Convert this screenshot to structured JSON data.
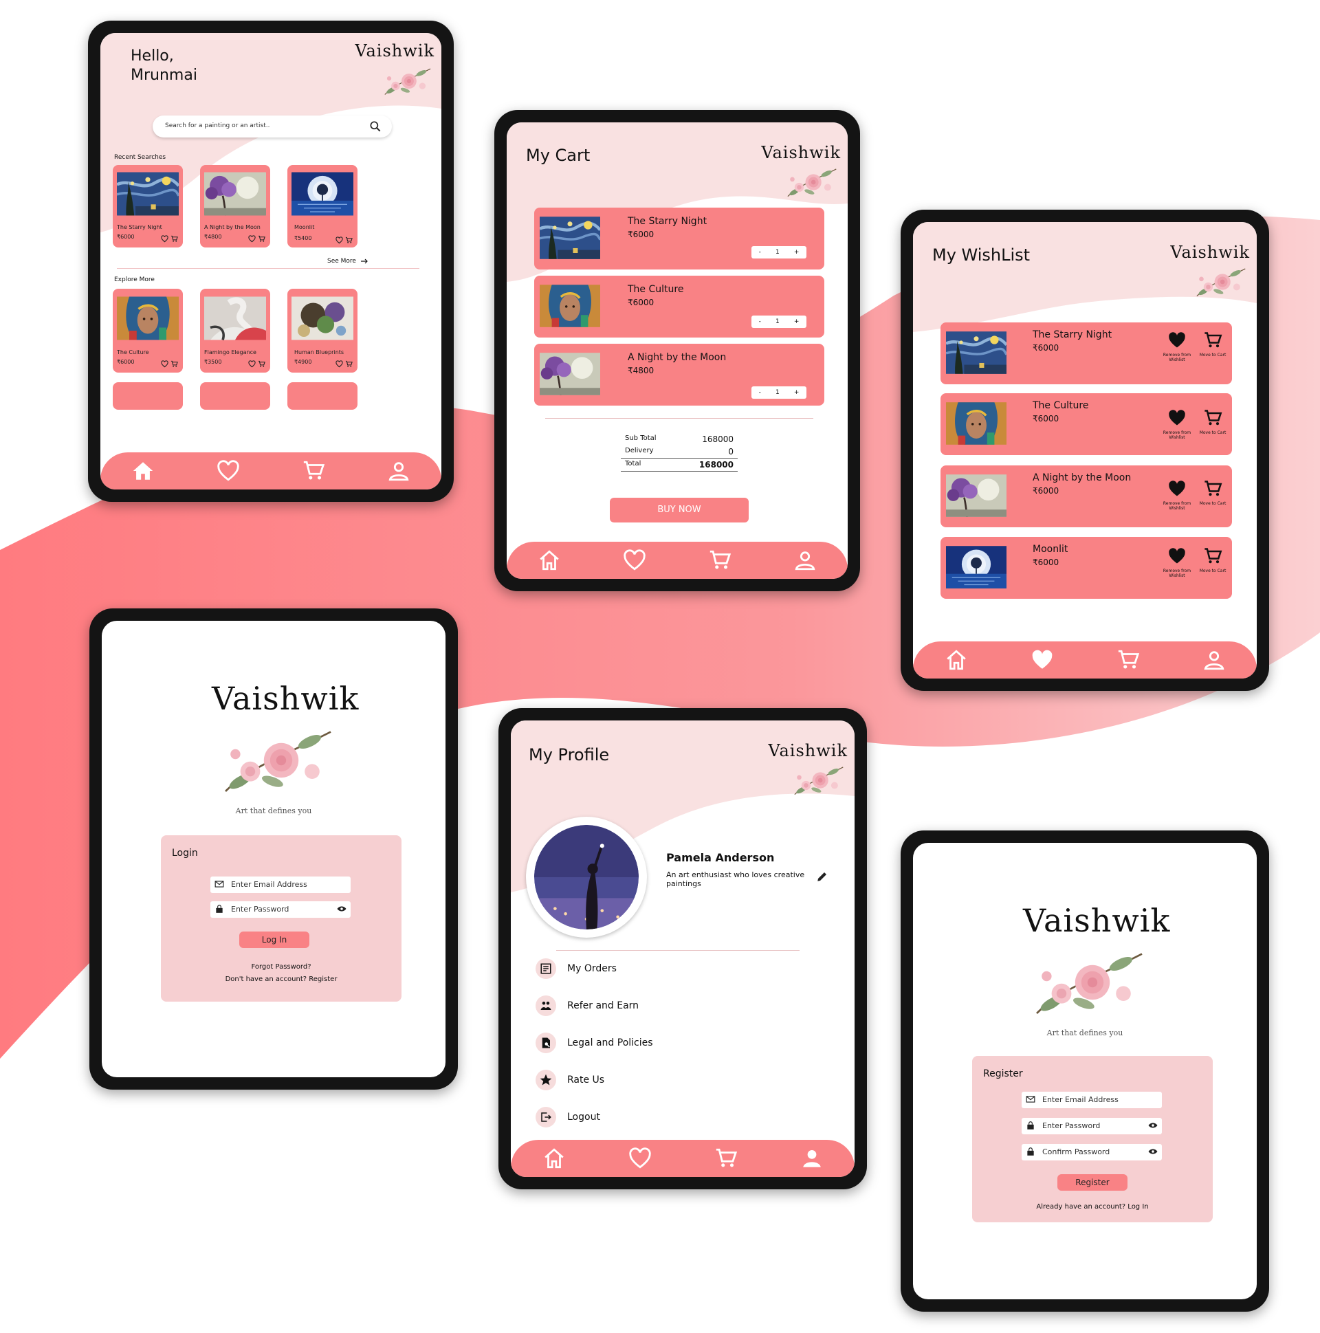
{
  "brand": {
    "name": "Vaishwik",
    "tagline": "Art that defines you",
    "accent": "#f98285",
    "light": "#f9e1e1",
    "panel": "#f6cfd1"
  },
  "home": {
    "greeting_line1": "Hello,",
    "greeting_line2": "Mrunmai",
    "search_placeholder": "Search for a painting or an artist..",
    "recent_label": "Recent Searches",
    "see_more": "See More",
    "explore_label": "Explore More",
    "recent": [
      {
        "title": "The Starry Night",
        "price": "₹6000"
      },
      {
        "title": "A Night by the Moon",
        "price": "₹4800"
      },
      {
        "title": "Moonlit",
        "price": "₹5400"
      }
    ],
    "explore": [
      {
        "title": "The Culture",
        "price": "₹6000"
      },
      {
        "title": "Flamingo Elegance",
        "price": "₹3500"
      },
      {
        "title": "Human Blueprints",
        "price": "₹4900"
      }
    ]
  },
  "cart": {
    "title": "My Cart",
    "items": [
      {
        "title": "The Starry Night",
        "price": "₹6000",
        "qty": "1"
      },
      {
        "title": "The Culture",
        "price": "₹6000",
        "qty": "1"
      },
      {
        "title": "A Night by the Moon",
        "price": "₹4800",
        "qty": "1"
      }
    ],
    "minus": "-",
    "plus": "+",
    "subtotal_label": "Sub Total",
    "subtotal": "168000",
    "delivery_label": "Delivery",
    "delivery": "0",
    "total_label": "Total",
    "total": "168000",
    "buy_now": "BUY NOW"
  },
  "wishlist": {
    "title": "My WishList",
    "remove_label": "Remove from Wishlist",
    "move_label": "Move to Cart",
    "items": [
      {
        "title": "The Starry Night",
        "price": "₹6000"
      },
      {
        "title": "The Culture",
        "price": "₹6000"
      },
      {
        "title": "A Night by the Moon",
        "price": "₹6000"
      },
      {
        "title": "Moonlit",
        "price": "₹6000"
      }
    ]
  },
  "login": {
    "heading": "Login",
    "email_placeholder": "Enter Email Address",
    "password_placeholder": "Enter Password",
    "button": "Log In",
    "forgot": "Forgot Password?",
    "register_prompt": "Don't have an account? Register"
  },
  "profile": {
    "title": "My Profile",
    "name": "Pamela Anderson",
    "bio": "An art enthusiast who loves creative paintings",
    "menu": [
      "My Orders",
      "Refer and Earn",
      "Legal and Policies",
      "Rate Us",
      "Logout"
    ]
  },
  "register": {
    "heading": "Register",
    "email_placeholder": "Enter Email Address",
    "password_placeholder": "Enter Password",
    "confirm_placeholder": "Confirm Password",
    "button": "Register",
    "login_prompt": "Already have an account? Log In"
  },
  "icons": [
    "home-icon",
    "heart-icon",
    "cart-icon",
    "profile-icon",
    "search-icon",
    "arrow-right-icon",
    "mail-icon",
    "lock-icon",
    "eye-icon",
    "edit-icon",
    "orders-icon",
    "refer-icon",
    "legal-icon",
    "star-icon",
    "logout-icon"
  ]
}
